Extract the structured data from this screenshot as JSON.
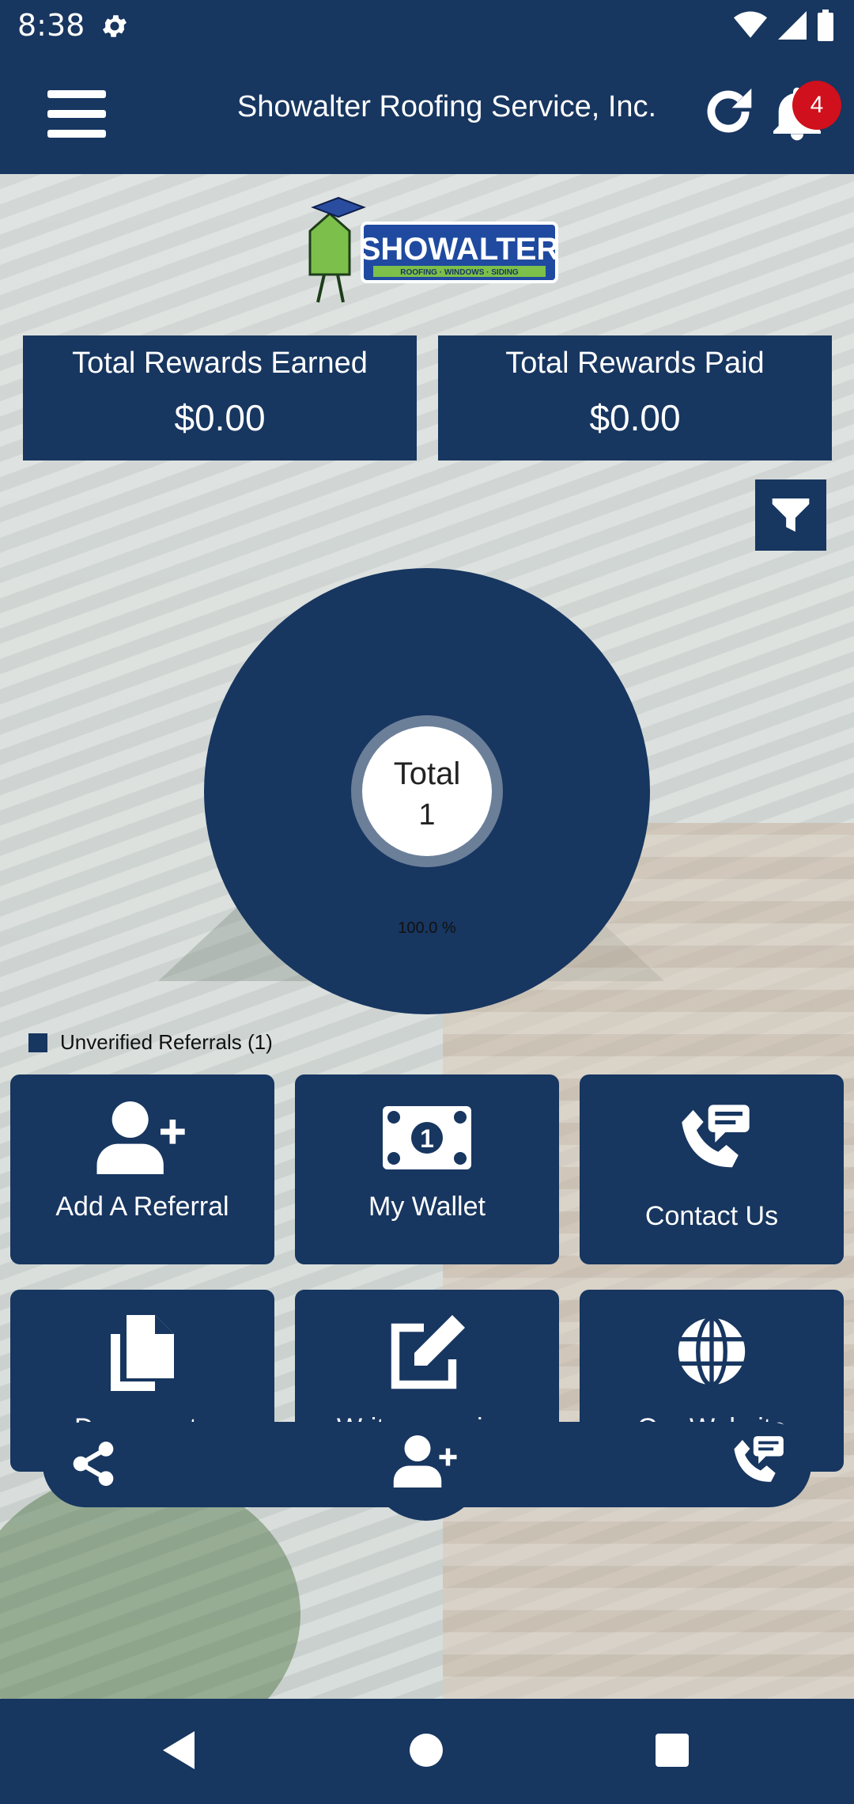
{
  "status": {
    "time": "8:38"
  },
  "header": {
    "title": "Showalter Roofing Service, Inc.",
    "notification_count": "4"
  },
  "logo": {
    "brand": "SHOWALTER",
    "tagline": "ROOFING · WINDOWS · SIDING"
  },
  "rewards": {
    "earned_label": "Total Rewards Earned",
    "earned_value": "$0.00",
    "paid_label": "Total Rewards Paid",
    "paid_value": "$0.00"
  },
  "chart": {
    "center_label": "Total",
    "center_value": "1",
    "slice_percent": "100.0 %",
    "legend_label": "Unverified Referrals (1)"
  },
  "tiles": {
    "add_referral": "Add A Referral",
    "my_wallet": "My Wallet",
    "contact_us": "Contact Us",
    "documents": "Documents",
    "write_review": "Write a Review",
    "our_website": "Our Website"
  },
  "colors": {
    "primary": "#173660",
    "badge": "#d0101c",
    "logo_green": "#7cc04b"
  }
}
